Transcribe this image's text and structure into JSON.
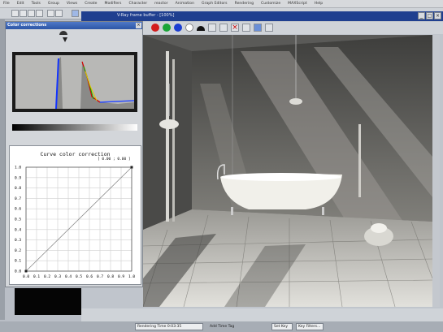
{
  "menu": [
    "File",
    "Edit",
    "Tools",
    "Group",
    "Views",
    "Create",
    "Modifiers",
    "Character",
    "reactor",
    "Animation",
    "Graph Editors",
    "Rendering",
    "Customize",
    "MAXScript",
    "Help"
  ],
  "vfb": {
    "title": "V-Ray frame buffer - [100%]"
  },
  "color_corrections": {
    "title": "Color corrections",
    "curve_title": "Curve color correction",
    "readout": "[ 0.00 ; 0.00 ]",
    "x_ticks": [
      "0.0",
      "0.1",
      "0.2",
      "0.3",
      "0.4",
      "0.5",
      "0.6",
      "0.7",
      "0.8",
      "0.9",
      "1.0"
    ],
    "y_ticks": [
      "1.0",
      "0.9",
      "0.8",
      "0.7",
      "0.6",
      "0.5",
      "0.4",
      "0.3",
      "0.2",
      "0.1",
      "0.0"
    ]
  },
  "statusbar": {
    "rendering_time": "Rendering Time 0:03:35",
    "add_time_tag": "Add Time Tag",
    "set_key": "Set Key",
    "key_filters": "Key Filters..."
  },
  "colors": {
    "titlebar": "#1f3f8f",
    "panel": "#d3d6da"
  }
}
